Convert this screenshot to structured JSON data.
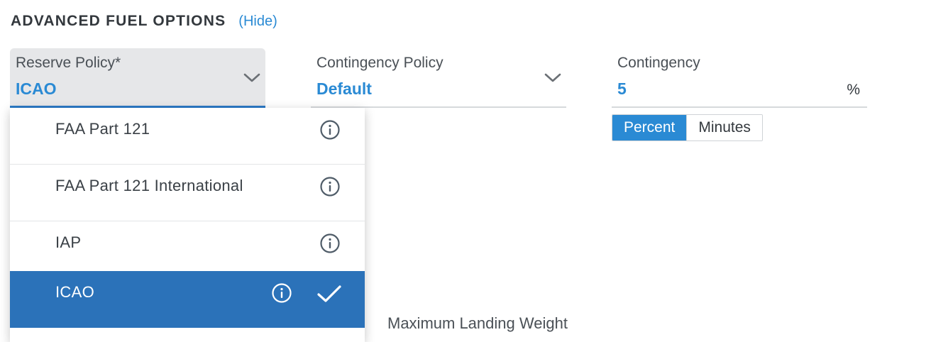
{
  "section": {
    "title": "ADVANCED FUEL OPTIONS",
    "toggle_link": "(Hide)"
  },
  "reserve_policy": {
    "label": "Reserve Policy*",
    "value": "ICAO"
  },
  "contingency_policy": {
    "label": "Contingency Policy",
    "value": "Default"
  },
  "contingency": {
    "label": "Contingency",
    "value": "5",
    "unit": "%"
  },
  "contingency_mode": {
    "options": [
      "Percent",
      "Minutes"
    ],
    "selected": "Percent"
  },
  "reserve_dropdown": {
    "items": [
      {
        "label": "FAA Part 121",
        "selected": false
      },
      {
        "label": "FAA Part 121 International",
        "selected": false
      },
      {
        "label": "IAP",
        "selected": false
      },
      {
        "label": "ICAO",
        "selected": true
      }
    ]
  },
  "max_landing_weight": {
    "label": "Maximum Landing Weight"
  },
  "colors": {
    "accent": "#2a8ad4",
    "selected_row": "#2b72b9",
    "text": "#33383d",
    "field_bg": "#e6e7e9"
  },
  "icons": {
    "chevron": "chevron-down-icon",
    "info": "info-icon",
    "check": "check-icon"
  }
}
